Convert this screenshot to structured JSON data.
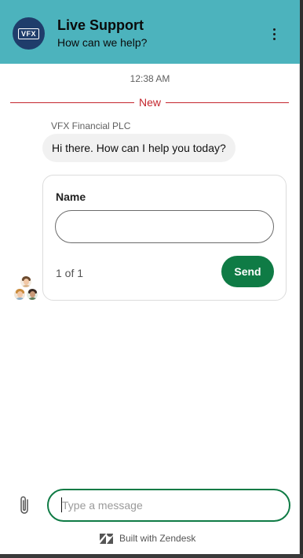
{
  "header": {
    "logo_text": "VFX",
    "title": "Live Support",
    "subtitle": "How can we help?",
    "menu_icon": "kebab-menu-icon"
  },
  "colors": {
    "header_bg": "#4cb3bd",
    "accent_green": "#0f7b45",
    "new_divider": "#c4262e",
    "bubble_bg": "#f1f1f1"
  },
  "conversation": {
    "timestamp": "12:38 AM",
    "new_label": "New",
    "sender": "VFX Financial PLC",
    "message": "Hi there. How can I help you today?"
  },
  "form": {
    "field_label": "Name",
    "field_value": "",
    "pager": "1 of 1",
    "send_label": "Send"
  },
  "composer": {
    "placeholder": "Type a message",
    "attach_icon": "paperclip-icon"
  },
  "footer": {
    "powered_by": "Built with Zendesk",
    "brand_icon": "zendesk-logo-icon"
  }
}
